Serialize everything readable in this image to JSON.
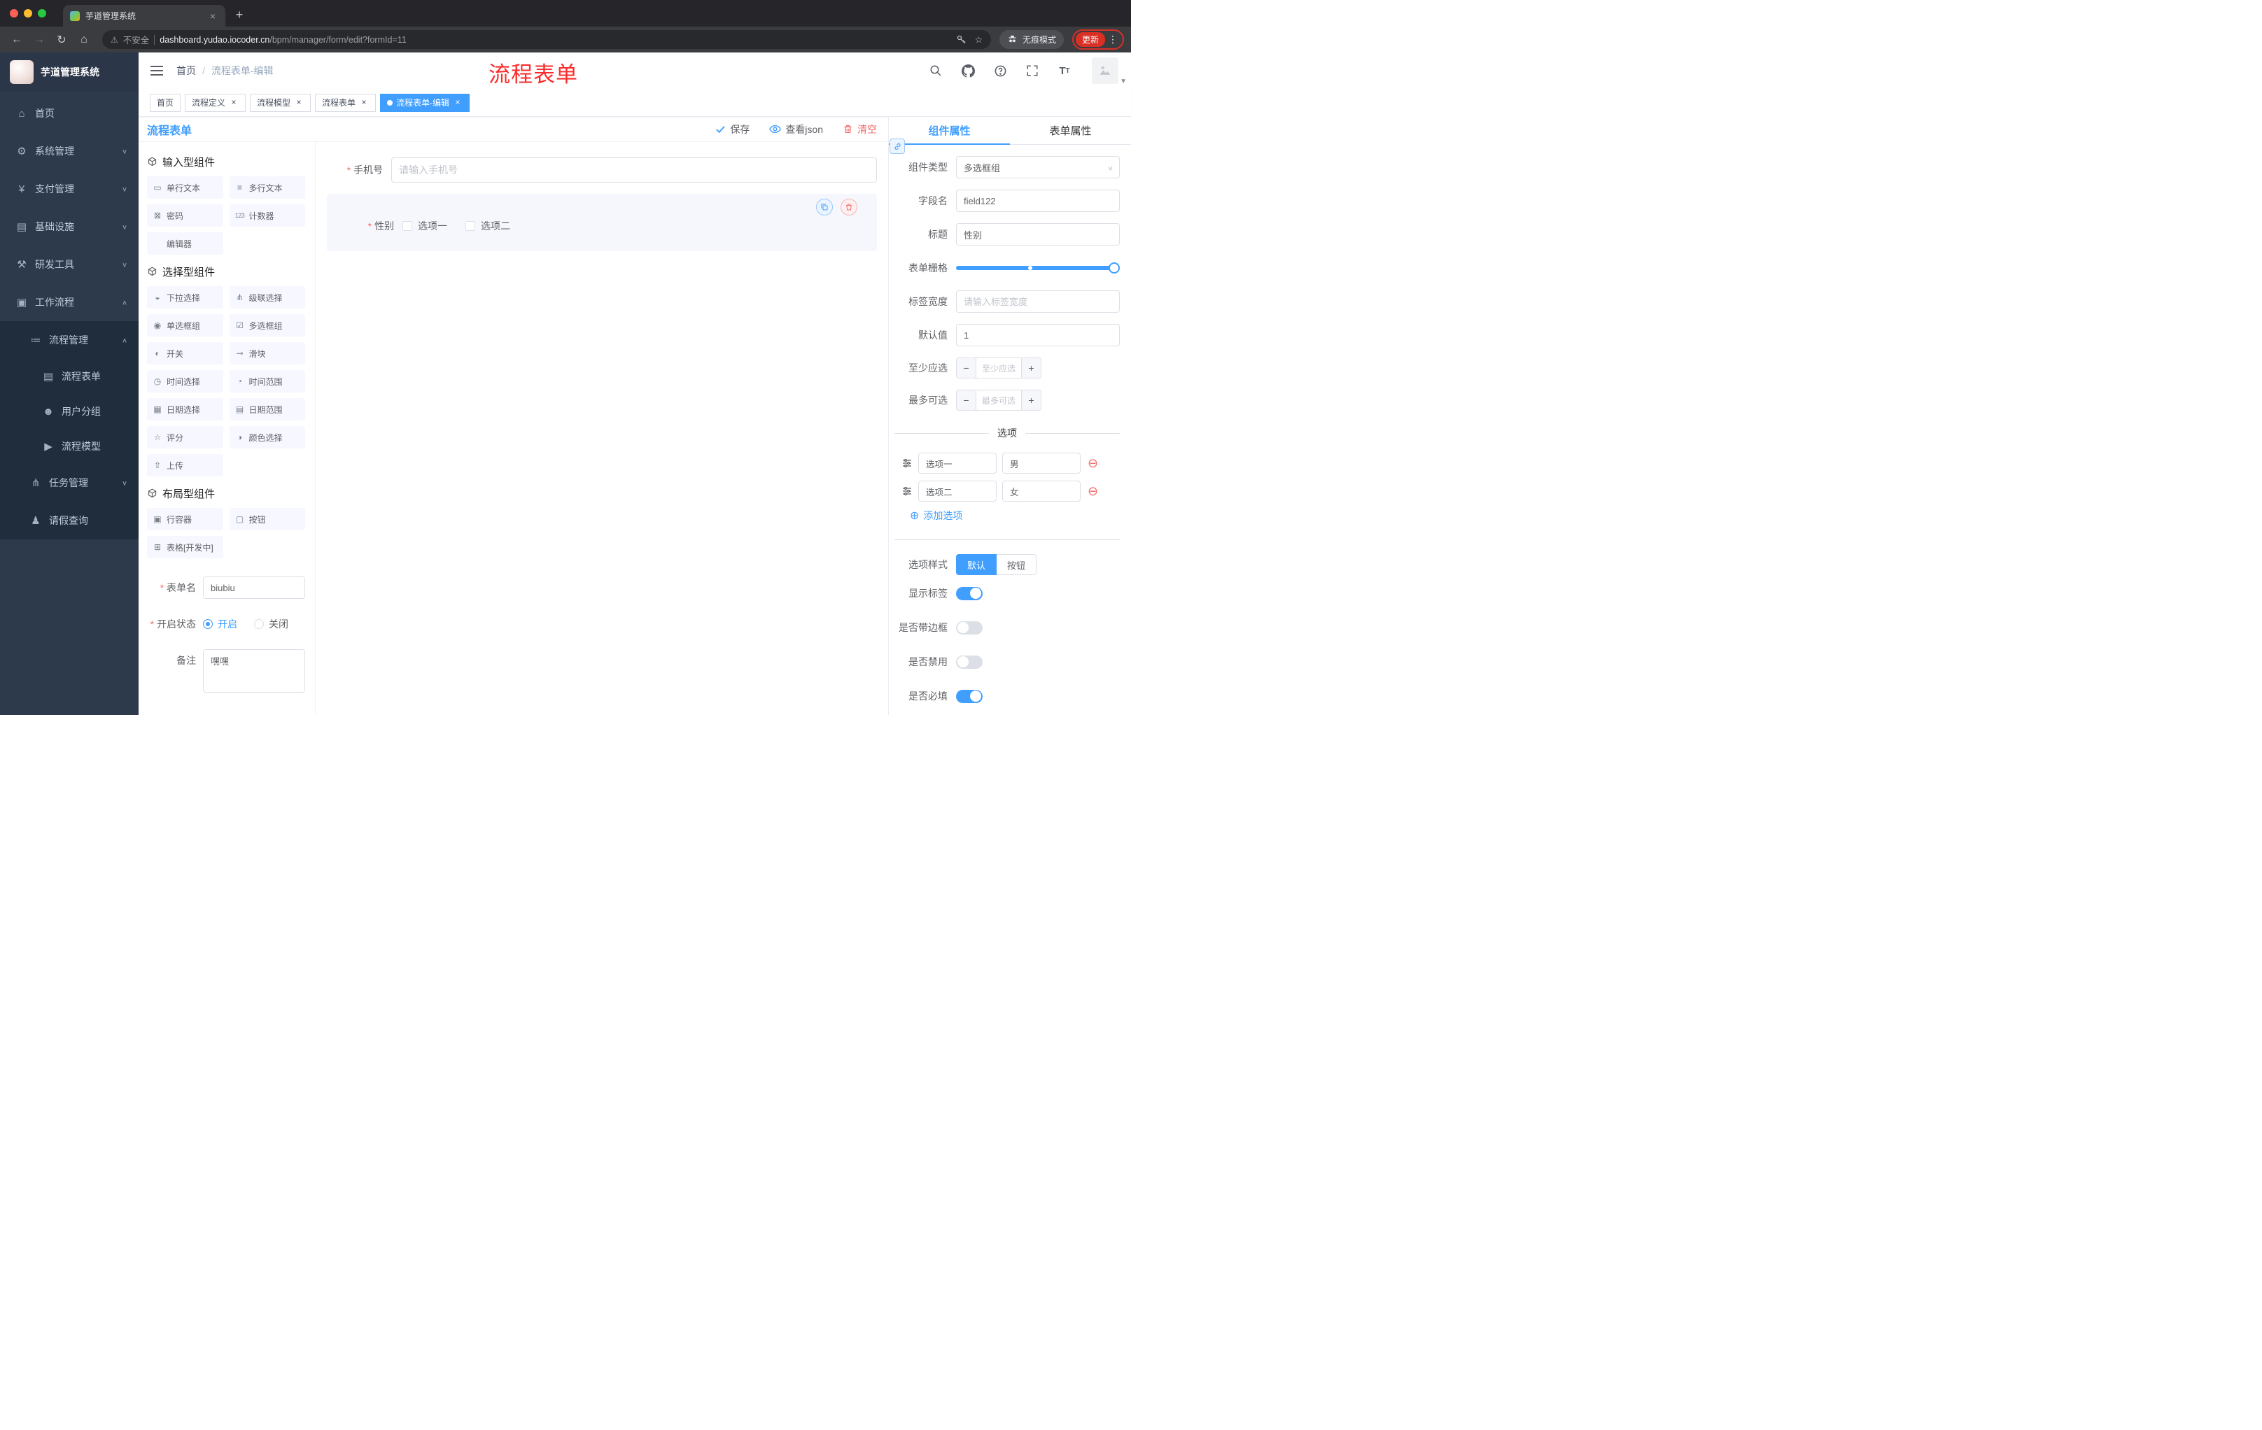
{
  "browser": {
    "tab_title": "芋道管理系统",
    "new_tab": "+",
    "address": {
      "security_label": "不安全",
      "host": "dashboard.yudao.iocoder.cn",
      "path": "/bpm/manager/form/edit?formId=11"
    },
    "incognito_label": "无痕模式",
    "update_label": "更新"
  },
  "sidebar": {
    "logo_title": "芋道管理系统",
    "items": [
      {
        "icon": "⌂",
        "label": "首页",
        "level": 0,
        "chevron": "",
        "sub": false
      },
      {
        "icon": "⚙",
        "label": "系统管理",
        "level": 0,
        "chevron": "∨",
        "sub": false
      },
      {
        "icon": "¥",
        "label": "支付管理",
        "level": 0,
        "chevron": "∨",
        "sub": false
      },
      {
        "icon": "▤",
        "label": "基础设施",
        "level": 0,
        "chevron": "∨",
        "sub": false
      },
      {
        "icon": "⚒",
        "label": "研发工具",
        "level": 0,
        "chevron": "∨",
        "sub": false
      },
      {
        "icon": "▣",
        "label": "工作流程",
        "level": 0,
        "chevron": "∧",
        "sub": false
      },
      {
        "icon": "≔",
        "label": "流程管理",
        "level": 1,
        "chevron": "∧",
        "sub": true
      },
      {
        "icon": "▤",
        "label": "流程表单",
        "level": 2,
        "chevron": "",
        "sub": true
      },
      {
        "icon": "☻",
        "label": "用户分组",
        "level": 2,
        "chevron": "",
        "sub": true
      },
      {
        "icon": "▶",
        "label": "流程模型",
        "level": 2,
        "chevron": "",
        "sub": true
      },
      {
        "icon": "⋔",
        "label": "任务管理",
        "level": 1,
        "chevron": "∨",
        "sub": true
      },
      {
        "icon": "♟",
        "label": "请假查询",
        "level": 1,
        "chevron": "",
        "sub": true
      }
    ]
  },
  "header": {
    "breadcrumb": {
      "home": "首页",
      "sep": "/",
      "current": "流程表单-编辑"
    },
    "annotation": "流程表单"
  },
  "tags": [
    {
      "label": "首页",
      "closable": false,
      "active": false
    },
    {
      "label": "流程定义",
      "closable": true,
      "active": false
    },
    {
      "label": "流程模型",
      "closable": true,
      "active": false
    },
    {
      "label": "流程表单",
      "closable": true,
      "active": false
    },
    {
      "label": "流程表单-编辑",
      "closable": true,
      "active": true
    }
  ],
  "designer": {
    "title": "流程表单",
    "toolbar": {
      "save": "保存",
      "view_json": "查看json",
      "clear": "清空"
    },
    "groups": {
      "input": {
        "title": "输入型组件",
        "items": [
          {
            "icon": "▭",
            "label": "单行文本"
          },
          {
            "icon": "≡",
            "label": "多行文本"
          },
          {
            "icon": "⊠",
            "label": "密码"
          },
          {
            "icon": "123",
            "label": "计数器",
            "num": true
          },
          {
            "icon": "",
            "label": "编辑器"
          }
        ]
      },
      "select": {
        "title": "选择型组件",
        "items": [
          {
            "icon": "◒",
            "label": "下拉选择"
          },
          {
            "icon": "⋔",
            "label": "级联选择"
          },
          {
            "icon": "◉",
            "label": "单选框组"
          },
          {
            "icon": "☑",
            "label": "多选框组"
          },
          {
            "icon": "◐",
            "label": "开关"
          },
          {
            "icon": "⊸",
            "label": "滑块"
          },
          {
            "icon": "◷",
            "label": "时间选择"
          },
          {
            "icon": "◔",
            "label": "时间范围"
          },
          {
            "icon": "▦",
            "label": "日期选择"
          },
          {
            "icon": "▤",
            "label": "日期范围"
          },
          {
            "icon": "☆",
            "label": "评分"
          },
          {
            "icon": "◑",
            "label": "颜色选择"
          },
          {
            "icon": "⇧",
            "label": "上传"
          }
        ]
      },
      "layout": {
        "title": "布局型组件",
        "items": [
          {
            "icon": "▣",
            "label": "行容器"
          },
          {
            "icon": "▢",
            "label": "按钮"
          },
          {
            "icon": "⊞",
            "label": "表格[开发中]"
          }
        ]
      }
    },
    "meta": {
      "name_label": "表单名",
      "name_value": "biubiu",
      "status_label": "开启状态",
      "status_options": [
        {
          "label": "开启",
          "selected": true
        },
        {
          "label": "关闭",
          "selected": false
        }
      ],
      "remark_label": "备注",
      "remark_value": "嘿嘿"
    },
    "canvas": {
      "phone": {
        "label": "手机号",
        "placeholder": "请输入手机号"
      },
      "gender": {
        "label": "性别",
        "options": [
          "选项一",
          "选项二"
        ]
      }
    }
  },
  "props": {
    "tabs": [
      {
        "label": "组件属性",
        "active": true
      },
      {
        "label": "表单属性",
        "active": false
      }
    ],
    "component_type": {
      "label": "组件类型",
      "value": "多选框组"
    },
    "field_name": {
      "label": "字段名",
      "value": "field122"
    },
    "title_field": {
      "label": "标题",
      "value": "性别"
    },
    "grid": {
      "label": "表单栅格"
    },
    "label_width": {
      "label": "标签宽度",
      "placeholder": "请输入标签宽度"
    },
    "default_value": {
      "label": "默认值",
      "value": "1"
    },
    "min_count": {
      "label": "至少应选",
      "placeholder": "至少应选"
    },
    "max_count": {
      "label": "最多可选",
      "placeholder": "最多可选"
    },
    "options": {
      "divider": "选项",
      "rows": [
        {
          "name": "选项一",
          "value": "男"
        },
        {
          "name": "选项二",
          "value": "女"
        }
      ],
      "add": "添加选项"
    },
    "style": {
      "label": "选项样式",
      "choices": [
        {
          "label": "默认",
          "active": true
        },
        {
          "label": "按钮",
          "active": false
        }
      ]
    },
    "toggles": [
      {
        "label": "显示标签",
        "on": true
      },
      {
        "label": "是否带边框",
        "on": false
      },
      {
        "label": "是否禁用",
        "on": false
      },
      {
        "label": "是否必填",
        "on": true
      }
    ],
    "colors": {
      "accent": "#409eff",
      "danger": "#f56c6c"
    }
  }
}
